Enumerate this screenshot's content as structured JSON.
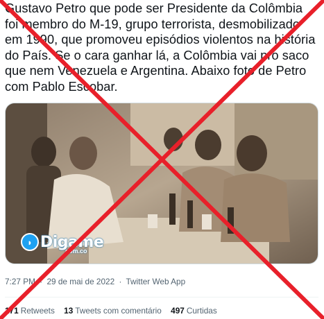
{
  "tweet": {
    "text_lines": [
      "Gustavo Petro que pode ser Presidente da Colômbia",
      "foi membro do M-19, grupo terrorista, desmobilizado",
      "em 1990, que promoveu episódios violentos na história",
      "do País. Se o cara ganhar lá, a Colômbia vai pro saco",
      "que nem Venezuela e Argentina. Abaixo foto de Petro",
      "com Pablo Escobar."
    ],
    "time": "7:27 PM",
    "date": "29 de mai de 2022",
    "source": "Twitter Web App",
    "separator": "·"
  },
  "photo": {
    "logo_text": "Digame",
    "logo_sub": "com.co"
  },
  "stats": {
    "retweets_count": "171",
    "retweets_label": "Retweets",
    "quotes_count": "13",
    "quotes_label": "Tweets com comentário",
    "likes_count": "497",
    "likes_label": "Curtidas"
  },
  "colors": {
    "cross": "#e8202a",
    "text": "#0f1419",
    "muted": "#536471",
    "logo": "#1ea1f1"
  }
}
